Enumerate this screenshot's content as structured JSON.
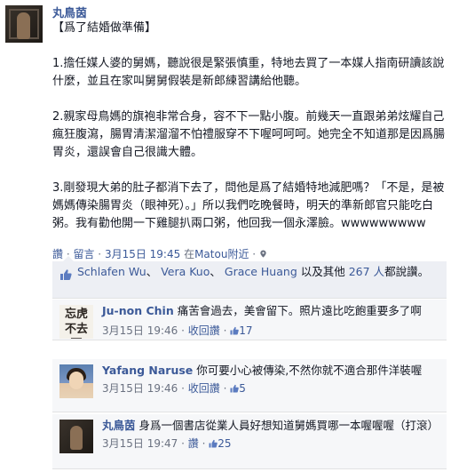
{
  "post": {
    "author": "丸鳥茵",
    "heading": "【爲了結婚做準備】",
    "paragraphs": [
      "1.擔任媒人婆的舅媽，聽說很是緊張慎重，特地去買了一本媒人指南研讀該說什麼，並且在家叫舅舅假裝是新郎練習講給他聽。",
      "2.親家母鳥媽的旗袍非常合身，容不下一點小腹。前幾天一直跟弟弟炫耀自己瘋狂腹瀉，腸胃清潔溜溜不怕禮服穿不下喔呵呵呵。她完全不知道那是因爲腸胃炎，還誤會自己很識大體。",
      "3.剛發現大弟的肚子都消下去了，問他是爲了結婚特地減肥嗎？「不是，是被媽媽傳染腸胃炎（眼神死）。」所以我們吃晚餐時，明天的準新郎官只能吃白粥。我有勸他開一下雞腿扒兩口粥，他回我一個永澤臉。wwwwwwwww"
    ],
    "actions": {
      "like": "讚",
      "sep1": " · ",
      "comment": "留言",
      "sep2": " · ",
      "date": "3月15日 19:45",
      "location_prefix": " 在",
      "location": "Matou附近",
      "sep3": " · "
    }
  },
  "likes": {
    "names": [
      "Schlafen Wu",
      "Vera Kuo",
      "Grace Huang"
    ],
    "sep": "、",
    "mid": " 以及其他 ",
    "others_count": "267",
    "suffix_people": " 人",
    "suffix": "都說讚。"
  },
  "comments": [
    {
      "name": "Ju-non Chin",
      "text": "痛苦會過去，美會留下。照片遠比吃飽重要多了啊",
      "date": "3月15日 19:46",
      "action": "收回讚",
      "likes": "17",
      "avatar_text": "忘虎 不去死"
    },
    {
      "name": "Yafang Naruse",
      "text": "你可要小心被傳染,不然你就不適合那件洋裝喔",
      "date": "3月15日 19:46",
      "action": "收回讚",
      "likes": "5"
    },
    {
      "name": "丸鳥茵",
      "text": "身爲一個書店從業人員好想知道舅媽買哪一本喔喔喔（打滾）",
      "date": "3月15日 19:47",
      "action": "讚",
      "likes": "25"
    }
  ],
  "meta_sep": " · ",
  "colors": {
    "link": "#3b5998",
    "likes_bg": "#edeff4",
    "comment_bg": "#f6f7f9",
    "meta": "#6a7180"
  },
  "icons": [
    "thumbs-up-icon",
    "location-pin-icon",
    "small-like-icon"
  ]
}
